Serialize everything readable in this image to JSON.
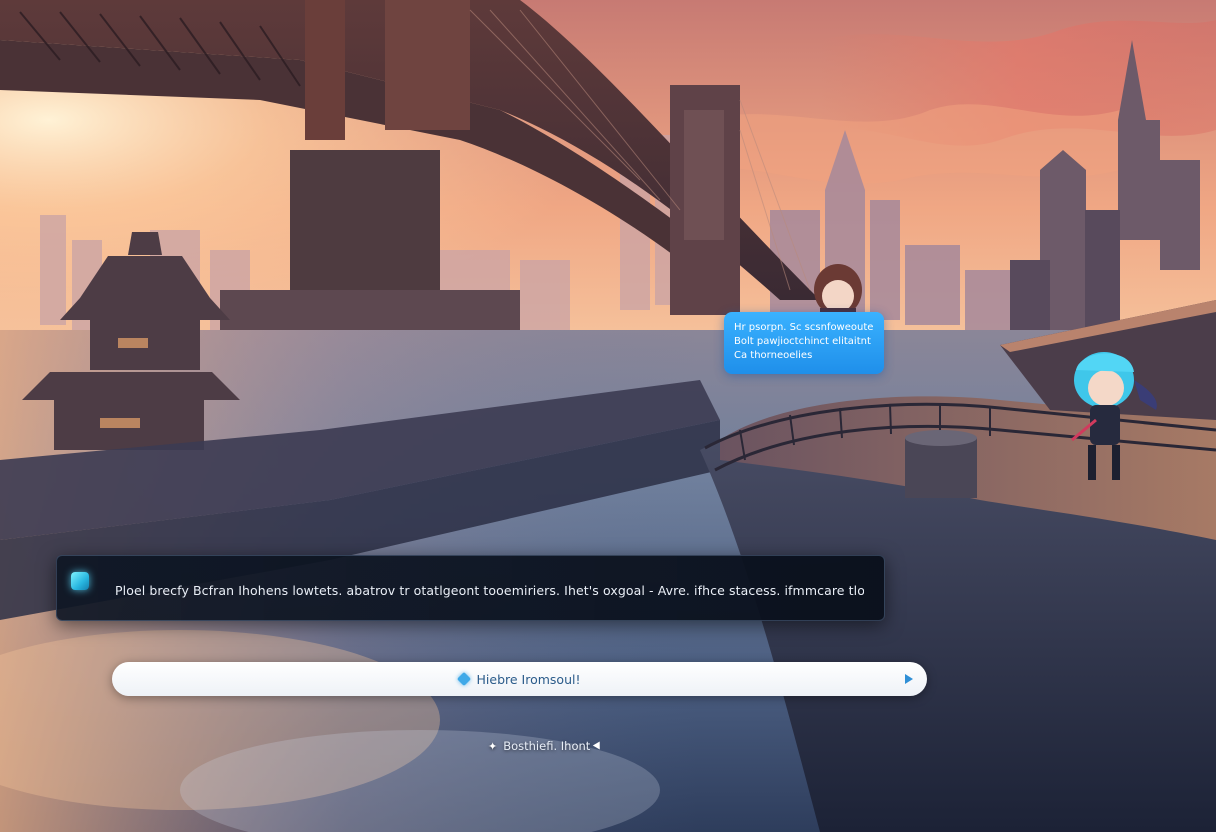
{
  "npc_bubble": {
    "lines": [
      "Hr psorpn. Sc scsnfoweoute",
      "Bolt pawjioctchinct elitaitnt",
      "Ca thorneoelies"
    ]
  },
  "dialogue": {
    "speaker_icon": "cyan-gem-icon",
    "text": "Ploel brecfy Bcfran Ihohens lowtets. abatrov tr otatlgeont tooemiriers. Ihet's oxgoal - Avre. ifhce stacess. ifmmcare tlortcfl"
  },
  "reply_input": {
    "icon": "spark-icon",
    "label": "Hiebre Iromsoul!",
    "send_icon": "send-arrow-icon"
  },
  "continue_hint": {
    "icon": "sparkle-icon",
    "label": "Bosthiefi. Ihont",
    "cursor_icon": "pointer-icon"
  },
  "colors": {
    "bubble": "#2fa4f5",
    "dialogue_bg": "#0e1624",
    "input_bg": "#ffffff",
    "accent_cyan": "#5ad8f5",
    "sky_top": "#f2b48c",
    "sky_glow": "#ffd9a8"
  }
}
